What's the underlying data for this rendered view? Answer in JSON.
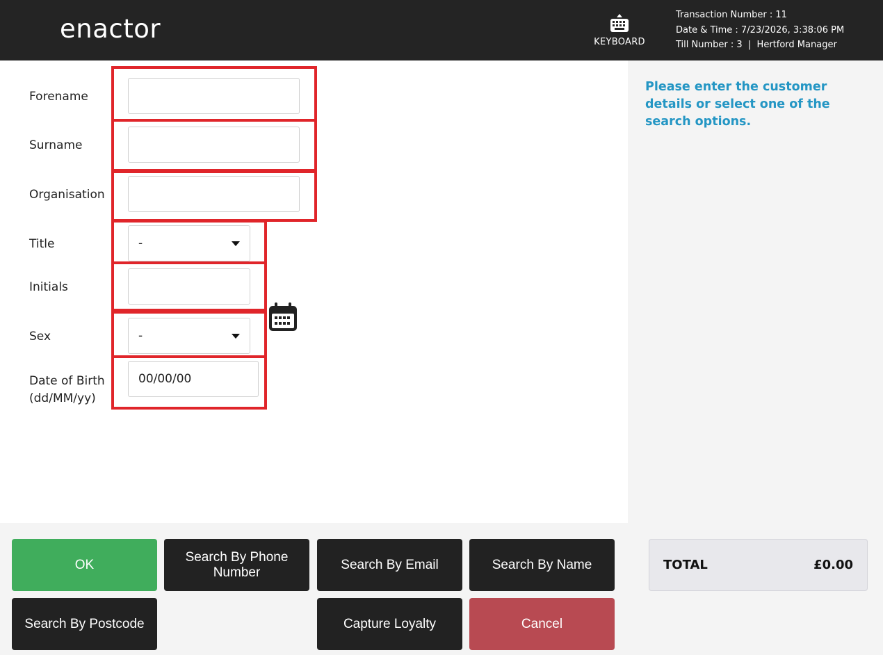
{
  "header": {
    "logo_text": "enactor",
    "keyboard_label": "KEYBOARD",
    "transaction_number": "Transaction Number : 11",
    "date_time": "Date & Time : 7/23/2026, 3:38:06 PM",
    "till_number": "Till Number : 3  |  Hertford Manager"
  },
  "form": {
    "forename_label": "Forename",
    "forename_value": "",
    "surname_label": "Surname",
    "surname_value": "",
    "organisation_label": "Organisation",
    "organisation_value": "",
    "title_label": "Title",
    "title_value": "-",
    "initials_label": "Initials",
    "initials_value": "",
    "sex_label": "Sex",
    "sex_value": "-",
    "dob_label_line1": "Date of Birth",
    "dob_label_line2": "(dd/MM/yy)",
    "dob_value": "00/00/00"
  },
  "info": {
    "message": "Please enter the customer details or select one of the search options."
  },
  "buttons": {
    "ok": "OK",
    "search_phone_line1": "Search By Phone",
    "search_phone_line2": "Number",
    "search_email": "Search By Email",
    "search_name": "Search By Name",
    "search_postcode": "Search By Postcode",
    "capture_loyalty": "Capture Loyalty",
    "cancel": "Cancel"
  },
  "total": {
    "label": "TOTAL",
    "value": "£0.00"
  },
  "colors": {
    "header_bg": "#242424",
    "accent_blue": "#2496c4",
    "ok_green": "#40ad5c",
    "cancel_red": "#b84a52",
    "highlight_red": "#e0252a"
  },
  "icons": {
    "keyboard": "keyboard-icon",
    "calendar": "calendar-icon",
    "dropdown": "chevron-down-icon"
  }
}
